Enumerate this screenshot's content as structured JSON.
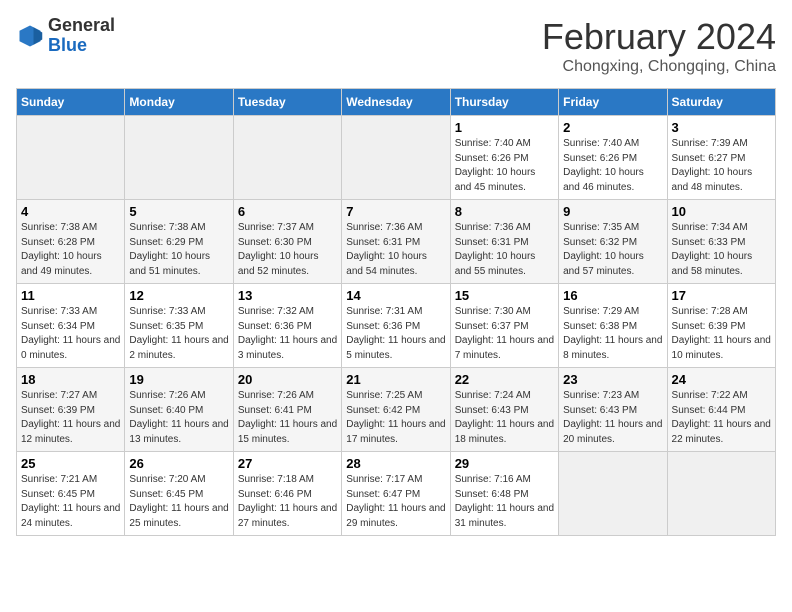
{
  "header": {
    "logo_general": "General",
    "logo_blue": "Blue",
    "month_title": "February 2024",
    "location": "Chongxing, Chongqing, China"
  },
  "weekdays": [
    "Sunday",
    "Monday",
    "Tuesday",
    "Wednesday",
    "Thursday",
    "Friday",
    "Saturday"
  ],
  "weeks": [
    [
      {
        "day": "",
        "info": ""
      },
      {
        "day": "",
        "info": ""
      },
      {
        "day": "",
        "info": ""
      },
      {
        "day": "",
        "info": ""
      },
      {
        "day": "1",
        "info": "Sunrise: 7:40 AM\nSunset: 6:26 PM\nDaylight: 10 hours and 45 minutes."
      },
      {
        "day": "2",
        "info": "Sunrise: 7:40 AM\nSunset: 6:26 PM\nDaylight: 10 hours and 46 minutes."
      },
      {
        "day": "3",
        "info": "Sunrise: 7:39 AM\nSunset: 6:27 PM\nDaylight: 10 hours and 48 minutes."
      }
    ],
    [
      {
        "day": "4",
        "info": "Sunrise: 7:38 AM\nSunset: 6:28 PM\nDaylight: 10 hours and 49 minutes."
      },
      {
        "day": "5",
        "info": "Sunrise: 7:38 AM\nSunset: 6:29 PM\nDaylight: 10 hours and 51 minutes."
      },
      {
        "day": "6",
        "info": "Sunrise: 7:37 AM\nSunset: 6:30 PM\nDaylight: 10 hours and 52 minutes."
      },
      {
        "day": "7",
        "info": "Sunrise: 7:36 AM\nSunset: 6:31 PM\nDaylight: 10 hours and 54 minutes."
      },
      {
        "day": "8",
        "info": "Sunrise: 7:36 AM\nSunset: 6:31 PM\nDaylight: 10 hours and 55 minutes."
      },
      {
        "day": "9",
        "info": "Sunrise: 7:35 AM\nSunset: 6:32 PM\nDaylight: 10 hours and 57 minutes."
      },
      {
        "day": "10",
        "info": "Sunrise: 7:34 AM\nSunset: 6:33 PM\nDaylight: 10 hours and 58 minutes."
      }
    ],
    [
      {
        "day": "11",
        "info": "Sunrise: 7:33 AM\nSunset: 6:34 PM\nDaylight: 11 hours and 0 minutes."
      },
      {
        "day": "12",
        "info": "Sunrise: 7:33 AM\nSunset: 6:35 PM\nDaylight: 11 hours and 2 minutes."
      },
      {
        "day": "13",
        "info": "Sunrise: 7:32 AM\nSunset: 6:36 PM\nDaylight: 11 hours and 3 minutes."
      },
      {
        "day": "14",
        "info": "Sunrise: 7:31 AM\nSunset: 6:36 PM\nDaylight: 11 hours and 5 minutes."
      },
      {
        "day": "15",
        "info": "Sunrise: 7:30 AM\nSunset: 6:37 PM\nDaylight: 11 hours and 7 minutes."
      },
      {
        "day": "16",
        "info": "Sunrise: 7:29 AM\nSunset: 6:38 PM\nDaylight: 11 hours and 8 minutes."
      },
      {
        "day": "17",
        "info": "Sunrise: 7:28 AM\nSunset: 6:39 PM\nDaylight: 11 hours and 10 minutes."
      }
    ],
    [
      {
        "day": "18",
        "info": "Sunrise: 7:27 AM\nSunset: 6:39 PM\nDaylight: 11 hours and 12 minutes."
      },
      {
        "day": "19",
        "info": "Sunrise: 7:26 AM\nSunset: 6:40 PM\nDaylight: 11 hours and 13 minutes."
      },
      {
        "day": "20",
        "info": "Sunrise: 7:26 AM\nSunset: 6:41 PM\nDaylight: 11 hours and 15 minutes."
      },
      {
        "day": "21",
        "info": "Sunrise: 7:25 AM\nSunset: 6:42 PM\nDaylight: 11 hours and 17 minutes."
      },
      {
        "day": "22",
        "info": "Sunrise: 7:24 AM\nSunset: 6:43 PM\nDaylight: 11 hours and 18 minutes."
      },
      {
        "day": "23",
        "info": "Sunrise: 7:23 AM\nSunset: 6:43 PM\nDaylight: 11 hours and 20 minutes."
      },
      {
        "day": "24",
        "info": "Sunrise: 7:22 AM\nSunset: 6:44 PM\nDaylight: 11 hours and 22 minutes."
      }
    ],
    [
      {
        "day": "25",
        "info": "Sunrise: 7:21 AM\nSunset: 6:45 PM\nDaylight: 11 hours and 24 minutes."
      },
      {
        "day": "26",
        "info": "Sunrise: 7:20 AM\nSunset: 6:45 PM\nDaylight: 11 hours and 25 minutes."
      },
      {
        "day": "27",
        "info": "Sunrise: 7:18 AM\nSunset: 6:46 PM\nDaylight: 11 hours and 27 minutes."
      },
      {
        "day": "28",
        "info": "Sunrise: 7:17 AM\nSunset: 6:47 PM\nDaylight: 11 hours and 29 minutes."
      },
      {
        "day": "29",
        "info": "Sunrise: 7:16 AM\nSunset: 6:48 PM\nDaylight: 11 hours and 31 minutes."
      },
      {
        "day": "",
        "info": ""
      },
      {
        "day": "",
        "info": ""
      }
    ]
  ]
}
